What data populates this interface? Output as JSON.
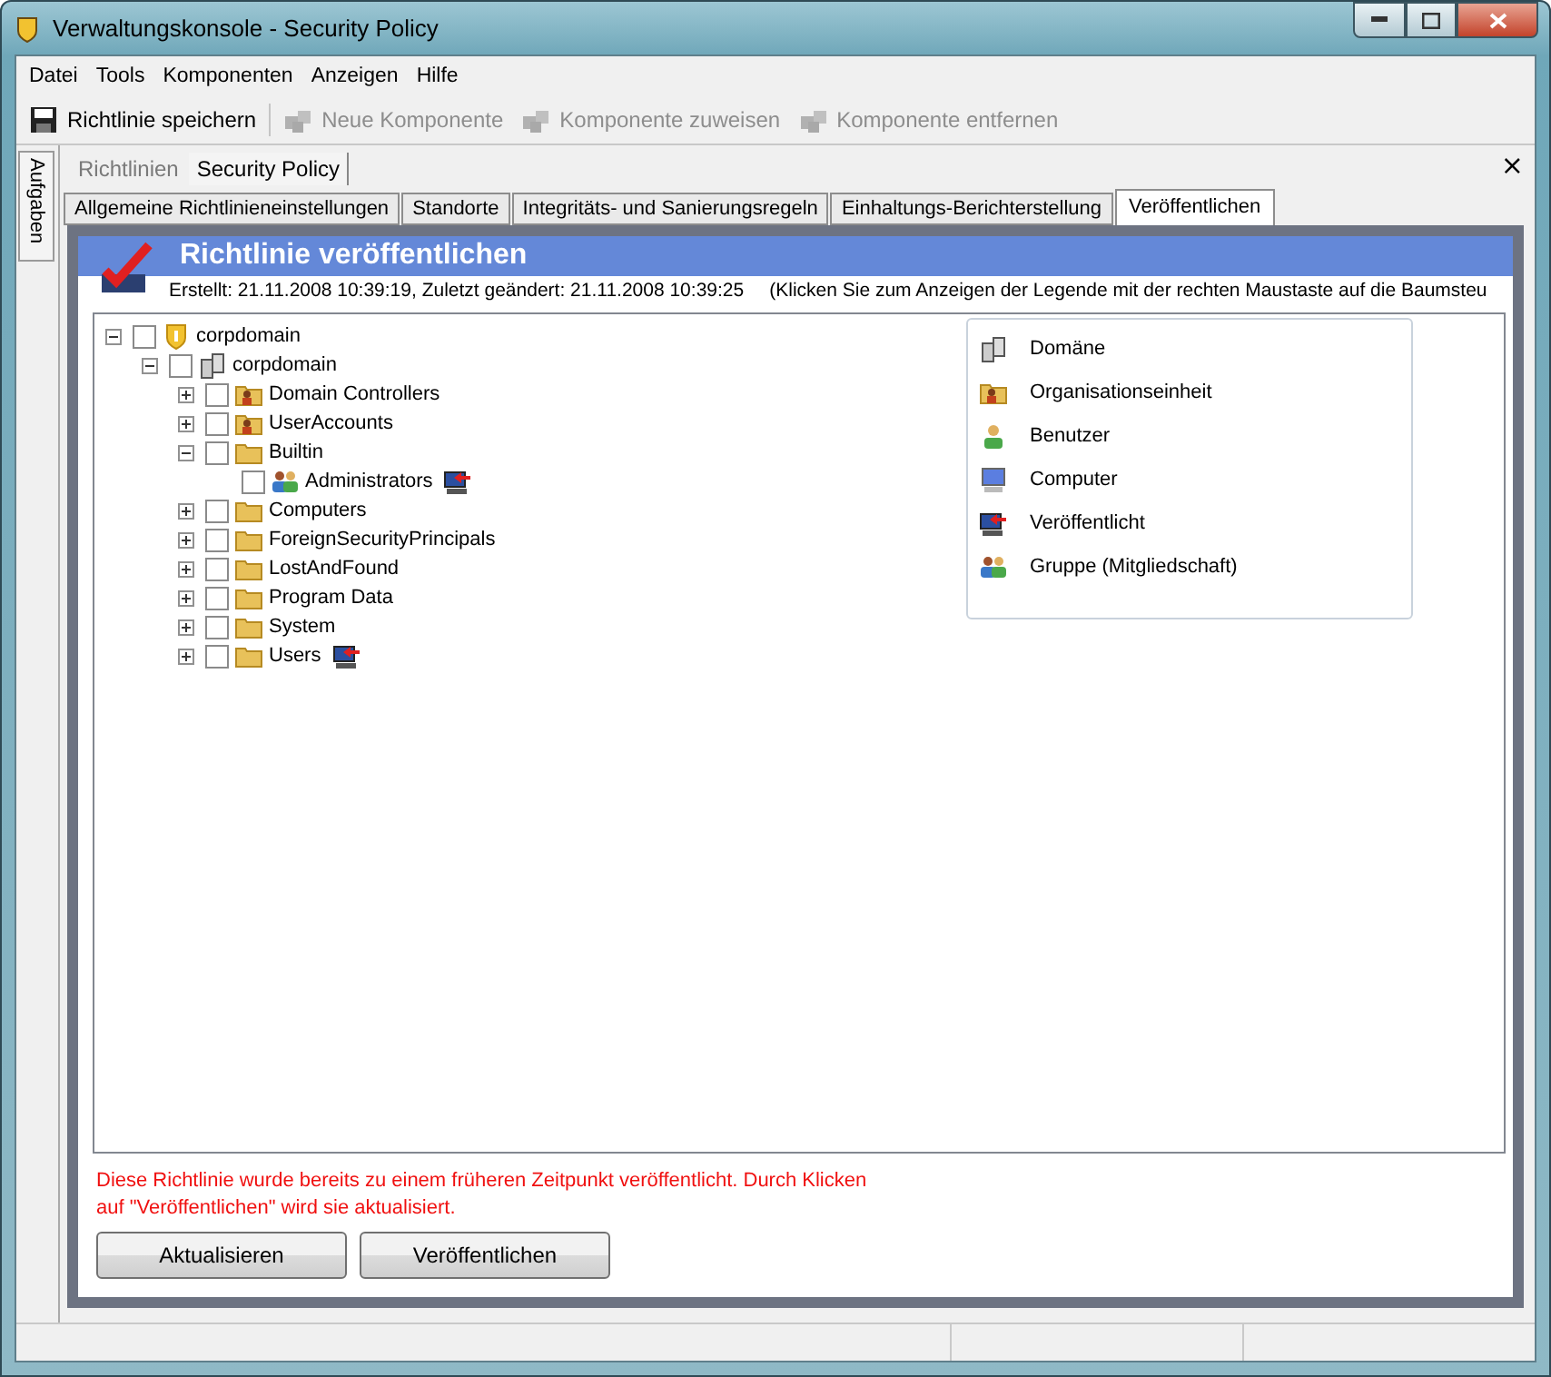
{
  "window": {
    "title": "Verwaltungskonsole - Security Policy"
  },
  "menu": [
    "Datei",
    "Tools",
    "Komponenten",
    "Anzeigen",
    "Hilfe"
  ],
  "toolbar": [
    {
      "kind": "save",
      "label": "Richtlinie speichern",
      "disabled": false
    },
    {
      "kind": "component",
      "label": "Neue Komponente",
      "disabled": true
    },
    {
      "kind": "component",
      "label": "Komponente zuweisen",
      "disabled": true
    },
    {
      "kind": "component",
      "label": "Komponente entfernen",
      "disabled": true
    }
  ],
  "side_tab": "Aufgaben",
  "breadcrumb": [
    {
      "label": "Richtlinien",
      "selected": false
    },
    {
      "label": "Security Policy",
      "selected": true
    }
  ],
  "close": "×",
  "tabs": [
    {
      "label": "Allgemeine Richtlinieneinstellungen",
      "selected": false
    },
    {
      "label": "Standorte",
      "selected": false
    },
    {
      "label": "Integritäts- und Sanierungsregeln",
      "selected": false
    },
    {
      "label": "Einhaltungs-Berichterstellung",
      "selected": false
    },
    {
      "label": "Veröffentlichen",
      "selected": true
    }
  ],
  "header": {
    "title": "Richtlinie veröffentlichen",
    "info": "Erstellt: 21.11.2008 10:39:19, Zuletzt geändert: 21.11.2008 10:39:25",
    "hint": "(Klicken Sie  zum Anzeigen der Legende mit der rechten Maustaste auf die Baumsteu"
  },
  "tree": [
    {
      "label": "corpdomain",
      "kind": "root",
      "checked": false,
      "expanded": true,
      "published": false,
      "children": [
        {
          "label": "corpdomain",
          "kind": "domain",
          "checked": false,
          "expanded": true,
          "published": false,
          "children": [
            {
              "label": "Domain Controllers",
              "kind": "ou",
              "checked": false,
              "expanded": false,
              "published": false
            },
            {
              "label": "UserAccounts",
              "kind": "ou",
              "checked": false,
              "expanded": false,
              "published": false
            },
            {
              "label": "Builtin",
              "kind": "folder",
              "checked": false,
              "expanded": true,
              "published": false,
              "children": [
                {
                  "label": "Administrators",
                  "kind": "group",
                  "checked": false,
                  "published": true
                }
              ]
            },
            {
              "label": "Computers",
              "kind": "folder",
              "checked": false,
              "expanded": false,
              "published": false
            },
            {
              "label": "ForeignSecurityPrincipals",
              "kind": "folder",
              "checked": false,
              "expanded": false,
              "published": false
            },
            {
              "label": "LostAndFound",
              "kind": "folder",
              "checked": false,
              "expanded": false,
              "published": false
            },
            {
              "label": "Program Data",
              "kind": "folder",
              "checked": false,
              "expanded": false,
              "published": false
            },
            {
              "label": "System",
              "kind": "folder",
              "checked": false,
              "expanded": false,
              "published": false
            },
            {
              "label": "Users",
              "kind": "folder",
              "checked": false,
              "expanded": false,
              "published": true
            }
          ]
        }
      ]
    }
  ],
  "legend": [
    {
      "kind": "domain",
      "label": "Domäne"
    },
    {
      "kind": "ou",
      "label": "Organisationseinheit"
    },
    {
      "kind": "user",
      "label": "Benutzer"
    },
    {
      "kind": "computer",
      "label": "Computer"
    },
    {
      "kind": "published",
      "label": "Veröffentlicht"
    },
    {
      "kind": "group",
      "label": "Gruppe (Mitgliedschaft)"
    }
  ],
  "message": "Diese Richtlinie wurde bereits zu einem früheren Zeitpunkt veröffentlicht. Durch Klicken auf \"Veröffentlichen\" wird sie aktualisiert.",
  "buttons": [
    "Aktualisieren",
    "Veröffentlichen"
  ]
}
